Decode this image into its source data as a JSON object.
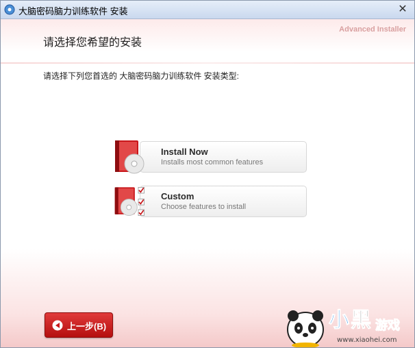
{
  "window": {
    "title": "大脑密码脑力训练软件 安装",
    "close_label": "✕"
  },
  "header": {
    "brand": "Advanced Installer",
    "heading": "请选择您希望的安装"
  },
  "main": {
    "subtext": "请选择下列您首选的 大脑密码脑力训练软件 安装类型:",
    "options": [
      {
        "title": "Install Now",
        "description": "Installs most common features"
      },
      {
        "title": "Custom",
        "description": "Choose features to install"
      }
    ]
  },
  "footer": {
    "back_label": "上一步(B)"
  },
  "watermark": {
    "logo": "小黑游戏",
    "url": "www.xiaohei.com"
  },
  "colors": {
    "accent": "#c8171b",
    "title_bar": "#dbe6f4"
  }
}
